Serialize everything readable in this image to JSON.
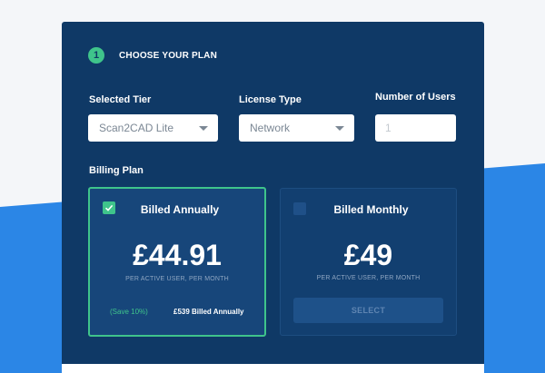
{
  "step": {
    "number": "1",
    "title": "CHOOSE YOUR PLAN"
  },
  "fields": {
    "tier_label": "Selected Tier",
    "tier_value": "Scan2CAD Lite",
    "license_label": "License Type",
    "license_value": "Network",
    "users_label": "Number of Users",
    "users_placeholder": "1"
  },
  "billing": {
    "label": "Billing Plan",
    "annual": {
      "title": "Billed Annually",
      "price": "£44.91",
      "subtext": "PER ACTIVE USER, PER MONTH",
      "save": "(Save 10%)",
      "billed_total": "£539 Billed Annually",
      "selected": true
    },
    "monthly": {
      "title": "Billed Monthly",
      "price": "£49",
      "subtext": "PER ACTIVE USER, PER MONTH",
      "button": "SELECT",
      "selected": false
    }
  },
  "colors": {
    "panel": "#0f3966",
    "accent_green": "#3fc48b",
    "background_blue": "#2b86e6"
  }
}
